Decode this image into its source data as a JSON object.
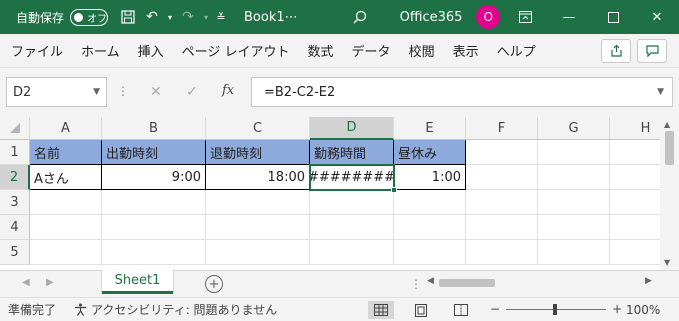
{
  "titlebar": {
    "autosave_label": "自動保存",
    "autosave_state": "オフ",
    "doc_name": "Book1⋯",
    "product": "Office365",
    "avatar_initial": "O",
    "accent": "#1e7145",
    "avatar_color": "#e3008c"
  },
  "ribbon": {
    "tabs": [
      "ファイル",
      "ホーム",
      "挿入",
      "ページ レイアウト",
      "数式",
      "データ",
      "校閲",
      "表示",
      "ヘルプ"
    ]
  },
  "formula_bar": {
    "name_box": "D2",
    "fx_label": "fx",
    "formula": "=B2-C2-E2"
  },
  "grid": {
    "columns": [
      "A",
      "B",
      "C",
      "D",
      "E",
      "F",
      "G",
      "H"
    ],
    "rows": [
      "1",
      "2",
      "3",
      "4",
      "5"
    ],
    "active_cell": "D2",
    "header_fill": "#8ea9db",
    "row1": [
      "名前",
      "出勤時刻",
      "退勤時刻",
      "勤務時間",
      "昼休み"
    ],
    "row2": [
      "Aさん",
      "9:00",
      "18:00",
      "########",
      "1:00"
    ]
  },
  "sheets": {
    "tabs": [
      "Sheet1"
    ],
    "active": "Sheet1"
  },
  "statusbar": {
    "ready": "準備完了",
    "accessibility": "アクセシビリティ: 問題ありません",
    "zoom": "100%",
    "zoom_minus": "−",
    "zoom_plus": "+"
  }
}
